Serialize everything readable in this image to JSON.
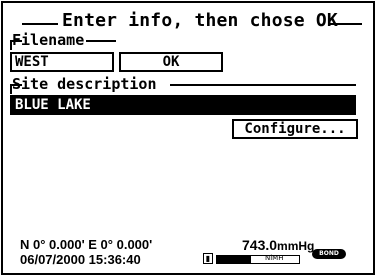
{
  "dialog": {
    "title": "Enter info, then chose OK"
  },
  "filename": {
    "label": "Filename",
    "value": "WEST",
    "ok_label": "OK"
  },
  "site": {
    "label": "Site description",
    "value": "BLUE LAKE",
    "configure_label": "Configure..."
  },
  "status": {
    "coordinates": "N 0° 0.000' E  0° 0.000'",
    "datetime": "06/07/2000 15:36:40",
    "pressure_value": "743.0",
    "pressure_unit": "mmHg",
    "battery_label": "NiMH",
    "battery_level_fraction": 0.42,
    "bond_badge": "BOND"
  }
}
